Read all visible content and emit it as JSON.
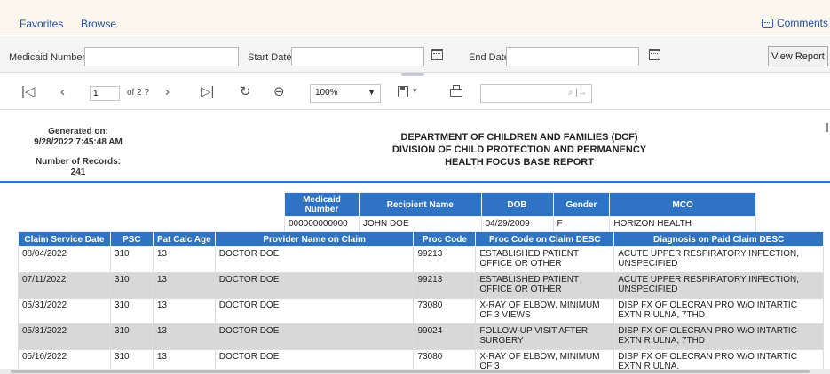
{
  "nav": {
    "favorites": "Favorites",
    "browse": "Browse",
    "comments": "Comments"
  },
  "params": {
    "medicaid_label": "Medicaid Number",
    "medicaid_value": "",
    "start_label": "Start Date",
    "start_value": "",
    "end_label": "End Date",
    "end_value": "",
    "view_report": "View Report"
  },
  "toolbar": {
    "page_value": "1",
    "of_pages": "of 2 ?",
    "zoom": "100%",
    "find_value": "",
    "icons": [
      "first-page-icon",
      "prev-page-icon",
      "next-page-icon",
      "last-page-icon",
      "refresh-icon",
      "back-icon",
      "save-icon",
      "print-icon",
      "search-icon",
      "find-next-icon"
    ]
  },
  "report": {
    "generated_label": "Generated on:",
    "generated_value": "9/28/2022 7:45:48 AM",
    "records_label": "Number of Records:",
    "records_value": "241",
    "title1": "DEPARTMENT OF CHILDREN AND FAMILIES (DCF)",
    "title2": "DIVISION OF CHILD PROTECTION AND PERMANENCY",
    "title3": "HEALTH FOCUS BASE REPORT"
  },
  "recipient": {
    "headers": [
      "Medicaid Number",
      "Recipient Name",
      "DOB",
      "Gender",
      "MCO"
    ],
    "row": [
      "000000000000",
      "JOHN DOE",
      "04/29/2009",
      "F",
      "HORIZON HEALTH"
    ]
  },
  "claims": {
    "headers": [
      "Claim Service Date",
      "PSC",
      "Pat Calc Age",
      "Provider Name on Claim",
      "Proc Code",
      "Proc Code on Claim DESC",
      "Diagnosis on Paid Claim DESC"
    ],
    "rows": [
      [
        "08/04/2022",
        "310",
        "13",
        "DOCTOR DOE",
        "99213",
        "ESTABLISHED PATIENT OFFICE OR OTHER",
        "ACUTE UPPER RESPIRATORY INFECTION, UNSPECIFIED"
      ],
      [
        "07/11/2022",
        "310",
        "13",
        "DOCTOR DOE",
        "99213",
        "ESTABLISHED PATIENT OFFICE OR OTHER",
        "ACUTE UPPER RESPIRATORY INFECTION, UNSPECIFIED"
      ],
      [
        "05/31/2022",
        "310",
        "13",
        "DOCTOR DOE",
        "73080",
        "X-RAY OF ELBOW, MINIMUM OF 3 VIEWS",
        "DISP FX OF OLECRAN PRO W/O INTARTIC EXTN R ULNA, 7THD"
      ],
      [
        "05/31/2022",
        "310",
        "13",
        "DOCTOR DOE",
        "99024",
        "FOLLOW-UP VISIT AFTER SURGERY",
        "DISP FX OF OLECRAN PRO W/O INTARTIC EXTN R ULNA, 7THD"
      ],
      [
        "05/16/2022",
        "310",
        "13",
        "DOCTOR DOE",
        "73080",
        "X-RAY OF ELBOW, MINIMUM OF 3",
        "DISP FX OF OLECRAN PRO W/O INTARTIC EXTN R ULNA,"
      ]
    ]
  }
}
